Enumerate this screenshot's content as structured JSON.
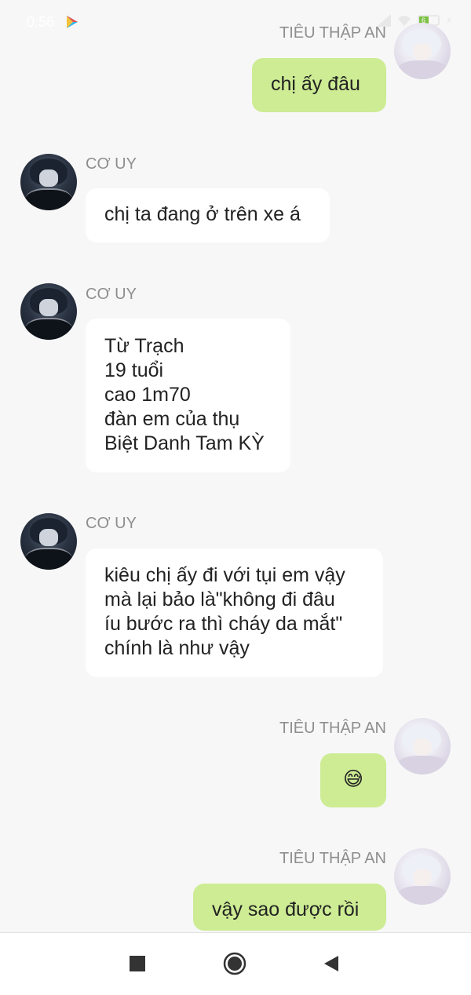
{
  "status_bar": {
    "time": "0:56",
    "battery_level": "6"
  },
  "messages": [
    {
      "sender": "TIÊU THẬP AN",
      "side": "right",
      "text": "chị ấy đâu"
    },
    {
      "sender": "CƠ UY",
      "side": "left",
      "text": "chị ta đang ở trên xe á"
    },
    {
      "sender": "CƠ UY",
      "side": "left",
      "text": "Từ Trạch\n19 tuổi\ncao 1m70\nđàn em của thụ\nBiệt Danh Tam KỲ"
    },
    {
      "sender": "CƠ UY",
      "side": "left",
      "text": "kiêu chị ấy đi với tụi em vậy\nmà lại bảo là\"không đi đâu\níu bước ra thì cháy da mắt\"\nchính là như vậy"
    },
    {
      "sender": "TIÊU THẬP AN",
      "side": "right",
      "text": "😅"
    },
    {
      "sender": "TIÊU THẬP AN",
      "side": "right",
      "text": "vậy sao được rồi"
    }
  ],
  "nav": {
    "recents_icon": "square-icon",
    "home_icon": "circle-icon",
    "back_icon": "triangle-back-icon"
  },
  "colors": {
    "background": "#f7f7f7",
    "left_bubble": "#ffffff",
    "right_bubble": "#cdec94",
    "sender_name": "#8e8e8e"
  }
}
